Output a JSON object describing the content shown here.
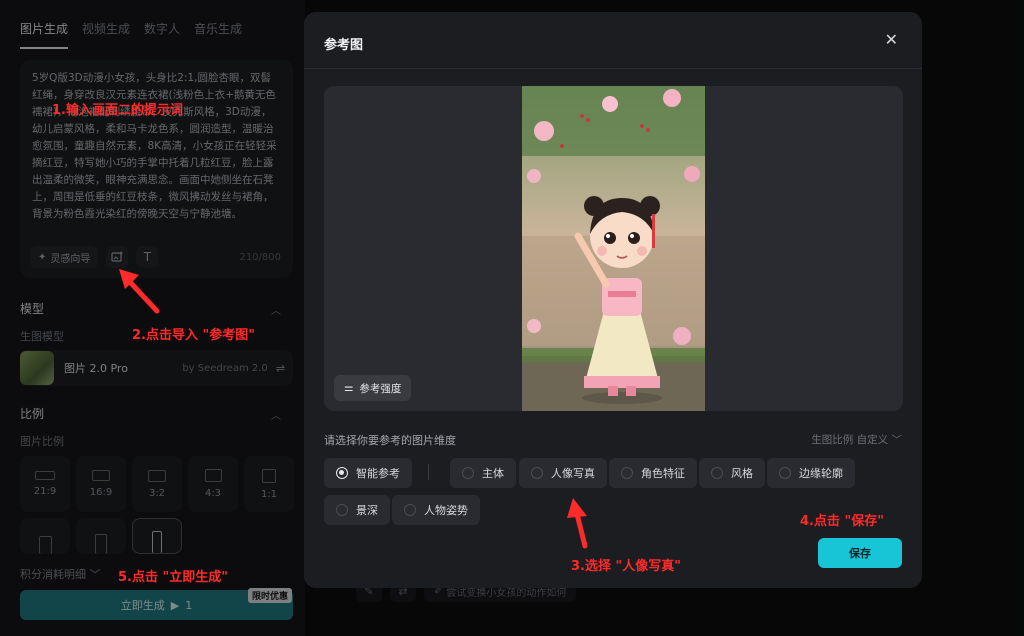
{
  "left_panel": {
    "tabs": [
      "图片生成",
      "视频生成",
      "数字人",
      "音乐生成"
    ],
    "prompt_text": "5岁Q版3D动漫小女孩，头身比2:1,圆脸杏眼，双髻红绳，身穿改良汉元素连衣裙(浅粉色上衣+鹅黄无色襦裙)，泡泡袖配刺绣腰带，皮克斯风格，3D动漫，幼儿启蒙风格，柔和马卡龙色系，圆润造型，温暖治愈氛围，童趣自然元素，8K高清，小女孩正在轻轻采摘红豆，特写她小巧的手掌中托着几粒红豆，脸上露出温柔的微笑，眼神充满思念。画面中她侧坐在石凳上，周围是低垂的红豆枝条，微风拂动发丝与裙角，背景为粉色霞光染红的傍晚天空与宁静池塘。",
    "inspire_label": "灵感向导",
    "counter": "210/800",
    "model_section": "模型",
    "model_sub": "生图模型",
    "model_name": "图片 2.0 Pro",
    "model_by": "by Seedream 2.0",
    "ratio_section": "比例",
    "ratio_sub": "图片比例",
    "ratios": [
      "21:9",
      "16:9",
      "3:2",
      "4:3",
      "1:1"
    ],
    "points_label": "积分消耗明细",
    "generate_label": "立即生成",
    "generate_cost": "1",
    "promo_label": "限时优惠"
  },
  "bottom_hint": "尝试变换小女孩的动作如何",
  "modal": {
    "title": "参考图",
    "strength_label": "参考强度",
    "dimension_label": "请选择你要参考的图片维度",
    "ratio_select_label": "生图比例 自定义",
    "options": [
      "智能参考",
      "主体",
      "人像写真",
      "角色特征",
      "风格",
      "边缘轮廓",
      "景深",
      "人物姿势"
    ],
    "selected_option": "智能参考",
    "save_label": "保存"
  },
  "annotations": {
    "step1": "1.输入画面二的提示词",
    "step2": "2.点击导入 \"参考图\"",
    "step3": "3.选择 \"人像写真\"",
    "step4": "4.点击 \"保存\"",
    "step5": "5.点击 \"立即生成\""
  },
  "colors": {
    "accent": "#17c5d7",
    "annotation": "#ff2a2a",
    "generate_button": "#1f7e85"
  }
}
